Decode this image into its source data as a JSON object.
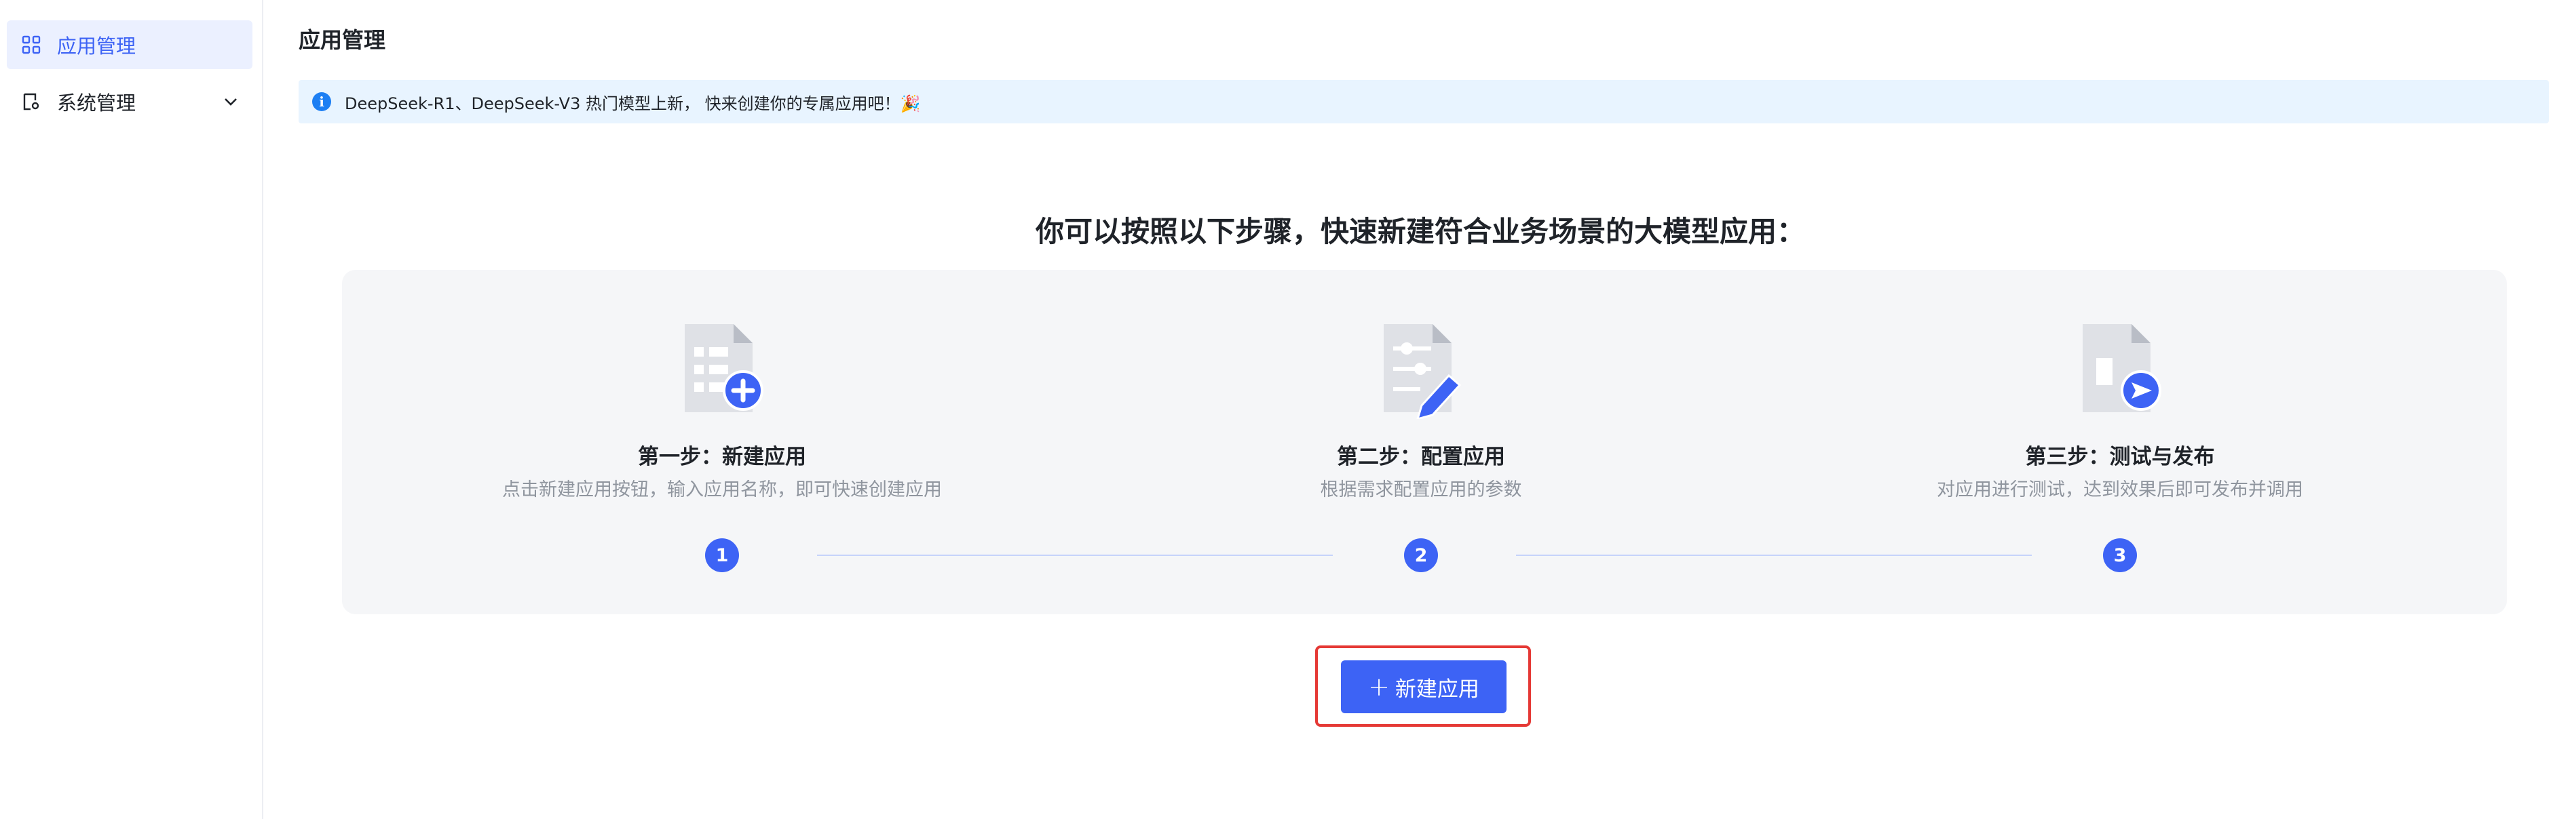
{
  "sidebar": {
    "items": [
      {
        "label": "应用管理",
        "icon": "grid-icon",
        "active": true
      },
      {
        "label": "系统管理",
        "icon": "settings-doc-icon",
        "expandable": true
      }
    ]
  },
  "main": {
    "title": "应用管理",
    "notice": {
      "text": "DeepSeek-R1、DeepSeek-V3 热门模型上新， 快来创建你的专属应用吧！🎉",
      "icon": "info-icon"
    },
    "headline": "你可以按照以下步骤，快速新建符合业务场景的大模型应用：",
    "steps": [
      {
        "number": "1",
        "title": "第一步：新建应用",
        "desc": "点击新建应用按钮，输入应用名称，即可快速创建应用",
        "icon": "new-doc-icon"
      },
      {
        "number": "2",
        "title": "第二步：配置应用",
        "desc": "根据需求配置应用的参数",
        "icon": "config-doc-icon"
      },
      {
        "number": "3",
        "title": "第三步：测试与发布",
        "desc": "对应用进行测试，达到效果后即可发布并调用",
        "icon": "publish-doc-icon"
      }
    ],
    "new_button": {
      "label": "新建应用",
      "icon": "plus-icon"
    }
  },
  "colors": {
    "accent": "#3d63f5",
    "highlight_border": "#e53935",
    "notice_bg": "#e8f4ff"
  }
}
